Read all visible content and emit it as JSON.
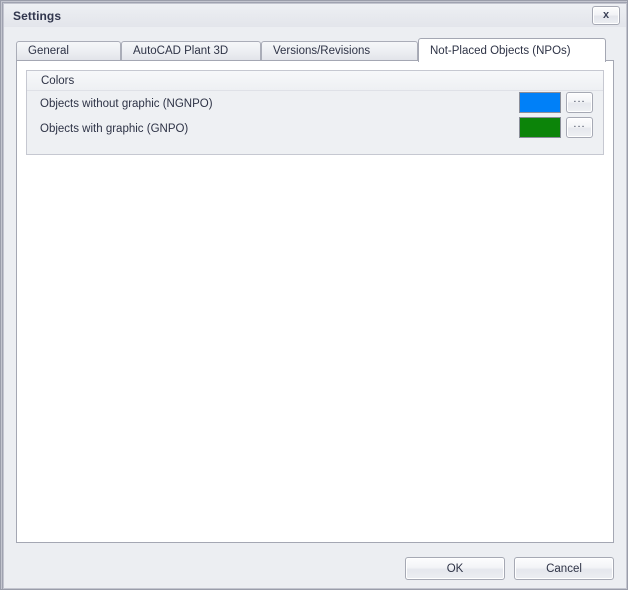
{
  "window": {
    "title": "Settings",
    "close_label": "x"
  },
  "tabs": [
    {
      "label": "General",
      "active": false
    },
    {
      "label": "AutoCAD Plant 3D",
      "active": false
    },
    {
      "label": "Versions/Revisions",
      "active": false
    },
    {
      "label": "Not-Placed Objects (NPOs)",
      "active": true
    }
  ],
  "group": {
    "title": "Colors",
    "rows": [
      {
        "label": "Objects without graphic (NGNPO)",
        "color": "#0080f8",
        "browse_label": "..."
      },
      {
        "label": "Objects with graphic (GNPO)",
        "color": "#0c8409",
        "browse_label": "..."
      }
    ]
  },
  "footer": {
    "ok_label": "OK",
    "cancel_label": "Cancel"
  }
}
